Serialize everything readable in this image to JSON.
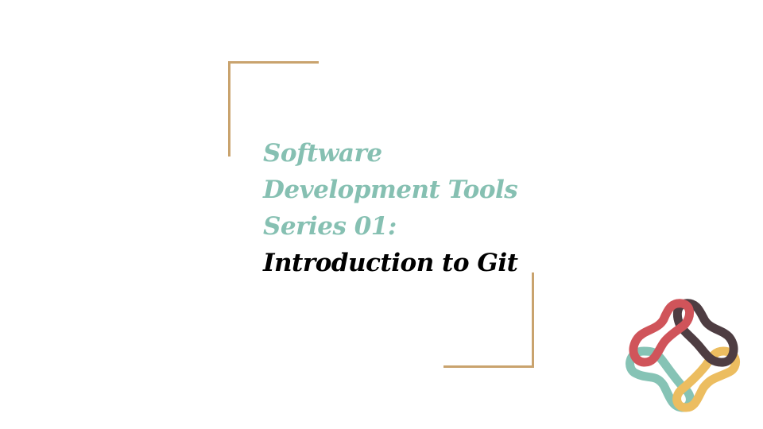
{
  "slide": {
    "title_lines": [
      "Software",
      "Development Tools",
      "Series 01:"
    ],
    "subtitle": "Introduction to Git"
  },
  "colors": {
    "accent_teal": "#86c0b2",
    "frame_tan": "#c9a36e",
    "logo_red": "#d0545a",
    "logo_dark": "#4e3d42",
    "logo_yellow": "#ecbd60",
    "logo_teal": "#86c3b5"
  },
  "logo": {
    "icon": "interlocking-loops-logo"
  }
}
